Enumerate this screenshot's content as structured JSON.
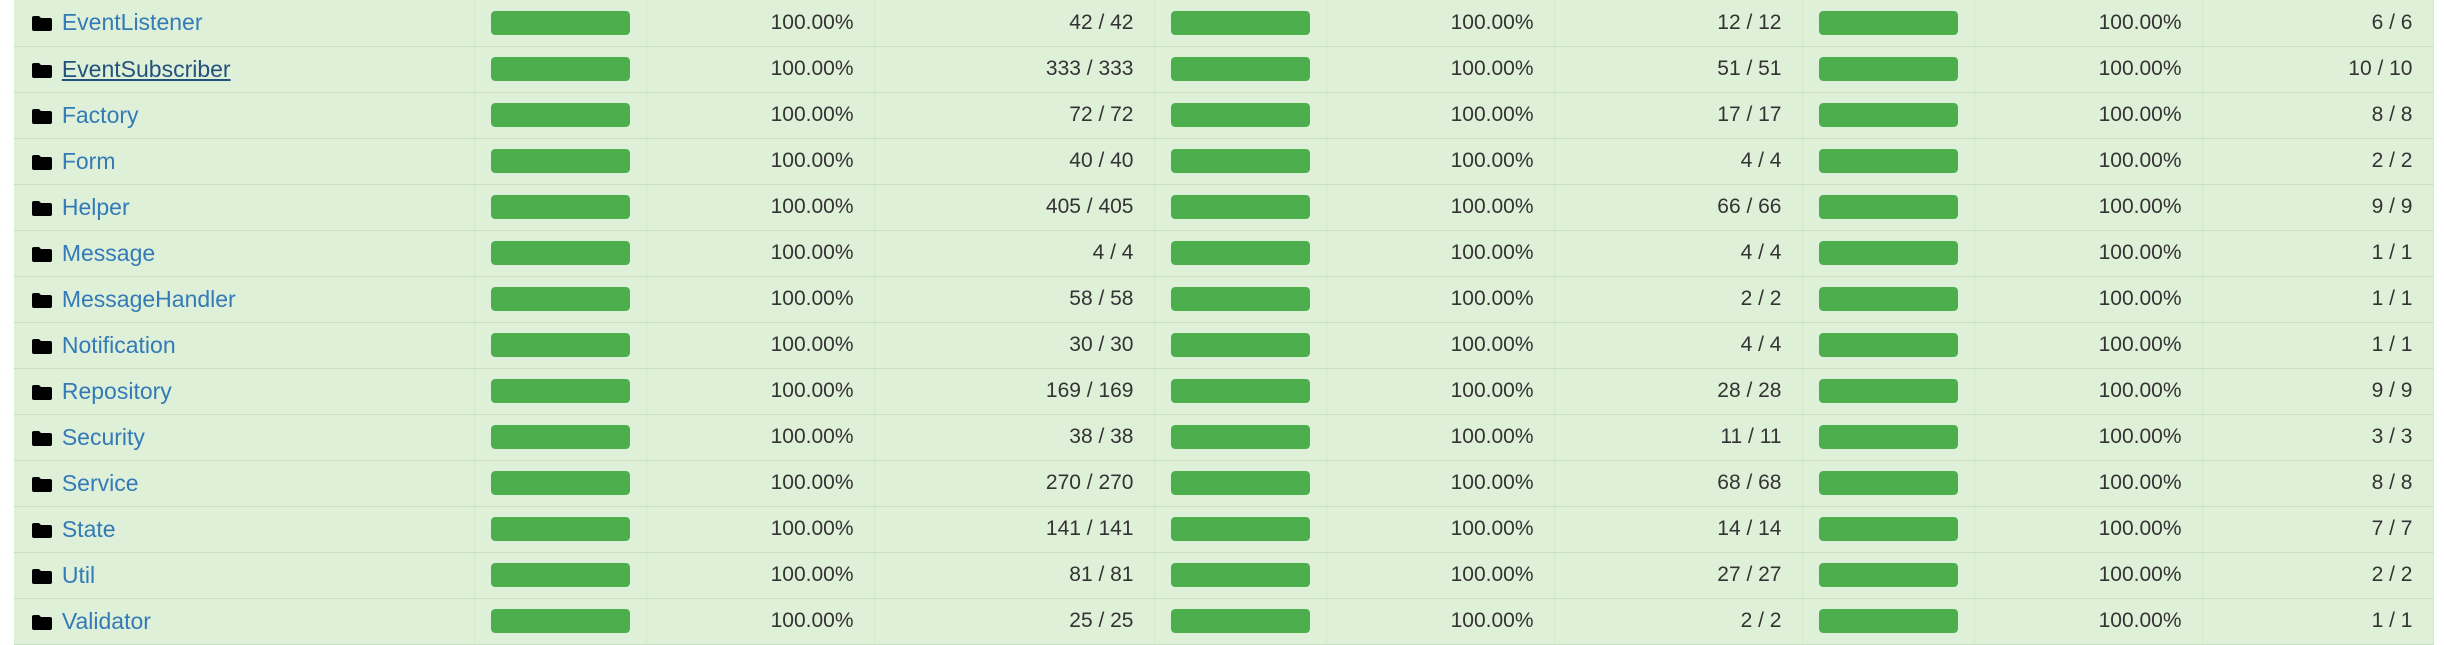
{
  "colors": {
    "row_bg": "#dff0d8",
    "bar": "#4cae4c",
    "link": "#337ab7"
  },
  "icons": {
    "row_icon": "folder-icon"
  },
  "rows": [
    {
      "name": "EventListener",
      "lines": {
        "percent": "100.00%",
        "fraction": "42 / 42",
        "level": 1
      },
      "functions": {
        "percent": "100.00%",
        "fraction": "12 / 12",
        "level": 1
      },
      "classes": {
        "percent": "100.00%",
        "fraction": "6 / 6",
        "level": 1
      }
    },
    {
      "name": "EventSubscriber",
      "hovered": true,
      "lines": {
        "percent": "100.00%",
        "fraction": "333 / 333",
        "level": 1
      },
      "functions": {
        "percent": "100.00%",
        "fraction": "51 / 51",
        "level": 1
      },
      "classes": {
        "percent": "100.00%",
        "fraction": "10 / 10",
        "level": 1
      }
    },
    {
      "name": "Factory",
      "lines": {
        "percent": "100.00%",
        "fraction": "72 / 72",
        "level": 1
      },
      "functions": {
        "percent": "100.00%",
        "fraction": "17 / 17",
        "level": 1
      },
      "classes": {
        "percent": "100.00%",
        "fraction": "8 / 8",
        "level": 1
      }
    },
    {
      "name": "Form",
      "lines": {
        "percent": "100.00%",
        "fraction": "40 / 40",
        "level": 1
      },
      "functions": {
        "percent": "100.00%",
        "fraction": "4 / 4",
        "level": 1
      },
      "classes": {
        "percent": "100.00%",
        "fraction": "2 / 2",
        "level": 1
      }
    },
    {
      "name": "Helper",
      "lines": {
        "percent": "100.00%",
        "fraction": "405 / 405",
        "level": 1
      },
      "functions": {
        "percent": "100.00%",
        "fraction": "66 / 66",
        "level": 1
      },
      "classes": {
        "percent": "100.00%",
        "fraction": "9 / 9",
        "level": 1
      }
    },
    {
      "name": "Message",
      "lines": {
        "percent": "100.00%",
        "fraction": "4 / 4",
        "level": 1
      },
      "functions": {
        "percent": "100.00%",
        "fraction": "4 / 4",
        "level": 1
      },
      "classes": {
        "percent": "100.00%",
        "fraction": "1 / 1",
        "level": 1
      }
    },
    {
      "name": "MessageHandler",
      "lines": {
        "percent": "100.00%",
        "fraction": "58 / 58",
        "level": 1
      },
      "functions": {
        "percent": "100.00%",
        "fraction": "2 / 2",
        "level": 1
      },
      "classes": {
        "percent": "100.00%",
        "fraction": "1 / 1",
        "level": 1
      }
    },
    {
      "name": "Notification",
      "lines": {
        "percent": "100.00%",
        "fraction": "30 / 30",
        "level": 1
      },
      "functions": {
        "percent": "100.00%",
        "fraction": "4 / 4",
        "level": 1
      },
      "classes": {
        "percent": "100.00%",
        "fraction": "1 / 1",
        "level": 1
      }
    },
    {
      "name": "Repository",
      "lines": {
        "percent": "100.00%",
        "fraction": "169 / 169",
        "level": 1
      },
      "functions": {
        "percent": "100.00%",
        "fraction": "28 / 28",
        "level": 1
      },
      "classes": {
        "percent": "100.00%",
        "fraction": "9 / 9",
        "level": 1
      }
    },
    {
      "name": "Security",
      "lines": {
        "percent": "100.00%",
        "fraction": "38 / 38",
        "level": 1
      },
      "functions": {
        "percent": "100.00%",
        "fraction": "11 / 11",
        "level": 1
      },
      "classes": {
        "percent": "100.00%",
        "fraction": "3 / 3",
        "level": 1
      }
    },
    {
      "name": "Service",
      "lines": {
        "percent": "100.00%",
        "fraction": "270 / 270",
        "level": 1
      },
      "functions": {
        "percent": "100.00%",
        "fraction": "68 / 68",
        "level": 1
      },
      "classes": {
        "percent": "100.00%",
        "fraction": "8 / 8",
        "level": 1
      }
    },
    {
      "name": "State",
      "lines": {
        "percent": "100.00%",
        "fraction": "141 / 141",
        "level": 1
      },
      "functions": {
        "percent": "100.00%",
        "fraction": "14 / 14",
        "level": 1
      },
      "classes": {
        "percent": "100.00%",
        "fraction": "7 / 7",
        "level": 1
      }
    },
    {
      "name": "Util",
      "lines": {
        "percent": "100.00%",
        "fraction": "81 / 81",
        "level": 1
      },
      "functions": {
        "percent": "100.00%",
        "fraction": "27 / 27",
        "level": 1
      },
      "classes": {
        "percent": "100.00%",
        "fraction": "2 / 2",
        "level": 1
      }
    },
    {
      "name": "Validator",
      "lines": {
        "percent": "100.00%",
        "fraction": "25 / 25",
        "level": 1
      },
      "functions": {
        "percent": "100.00%",
        "fraction": "2 / 2",
        "level": 1
      },
      "classes": {
        "percent": "100.00%",
        "fraction": "1 / 1",
        "level": 1
      }
    }
  ]
}
